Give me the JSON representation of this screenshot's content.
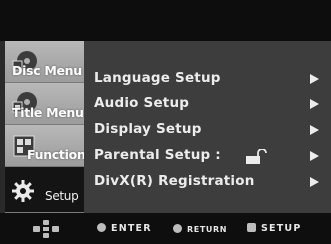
{
  "sidebar": {
    "items": [
      {
        "label": "Disc Menu"
      },
      {
        "label": "Title Menu"
      },
      {
        "label": "Function"
      },
      {
        "label": "Setup"
      }
    ]
  },
  "menu": {
    "items": [
      {
        "label": "Language Setup"
      },
      {
        "label": "Audio Setup"
      },
      {
        "label": "Display Setup"
      },
      {
        "label": "Parental Setup :"
      },
      {
        "label": "DivX(R) Registration"
      }
    ]
  },
  "footer": {
    "enter": "ENTER",
    "return": "RETURN",
    "setup": "SETUP"
  },
  "icons": {
    "disc_menu": "disc-icon",
    "title_menu": "title-icon",
    "function": "function-icon",
    "setup": "gear-icon",
    "parental": "unlock-icon",
    "navigation": "dpad-icon",
    "arrow": "right-arrow-icon"
  },
  "colors": {
    "sidebar_item": "#b0b0b0",
    "active_item": "#141414",
    "menu_background": "#3d3d3d",
    "text": "#ececec"
  }
}
